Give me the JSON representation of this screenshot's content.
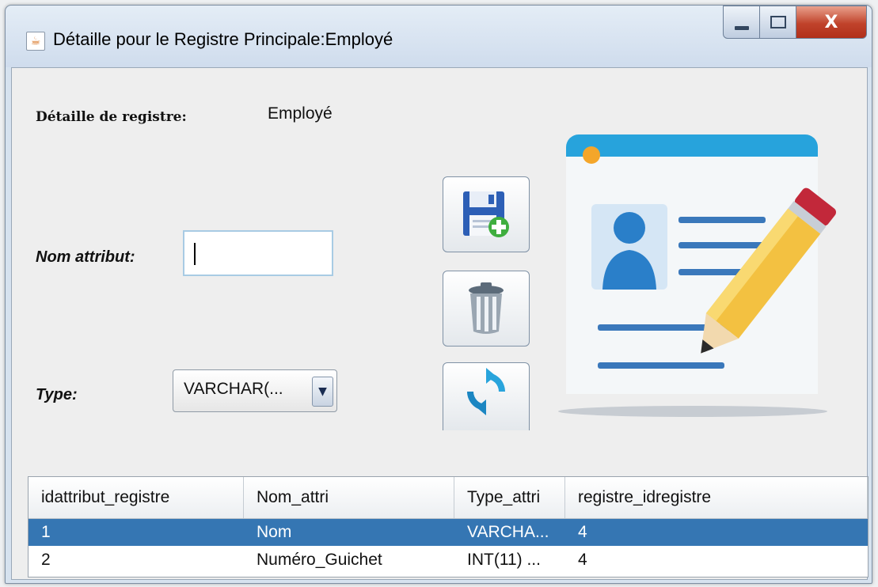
{
  "window": {
    "title": "Détaille pour le Registre Principale:Employé",
    "app_icon": "java-icon",
    "controls": {
      "minimize": "minimize-icon",
      "maximize": "maximize-icon",
      "close": "X"
    }
  },
  "form": {
    "detail_label": "Détaille de registre:",
    "detail_value": "Employé",
    "nom_label": "Nom attribut:",
    "nom_value": "",
    "type_label": "Type:",
    "type_selected": "VARCHAR(..."
  },
  "buttons": {
    "save": {
      "icon": "save-add-icon"
    },
    "delete": {
      "icon": "trash-icon"
    },
    "refresh": {
      "icon": "refresh-icon"
    }
  },
  "illustration": {
    "icon": "edit-profile-icon"
  },
  "table": {
    "columns": [
      "idattribut_registre",
      "Nom_attri",
      "Type_attri",
      "registre_idregistre"
    ],
    "rows": [
      {
        "cells": [
          "1",
          "Nom",
          "VARCHA...",
          "4"
        ],
        "selected": true
      },
      {
        "cells": [
          "2",
          "Numéro_Guichet",
          "INT(11) ...",
          "4"
        ],
        "selected": false
      }
    ]
  },
  "colors": {
    "selection": "#3576b3",
    "accent_blue": "#29a4dc",
    "close_red": "#c0432b"
  }
}
